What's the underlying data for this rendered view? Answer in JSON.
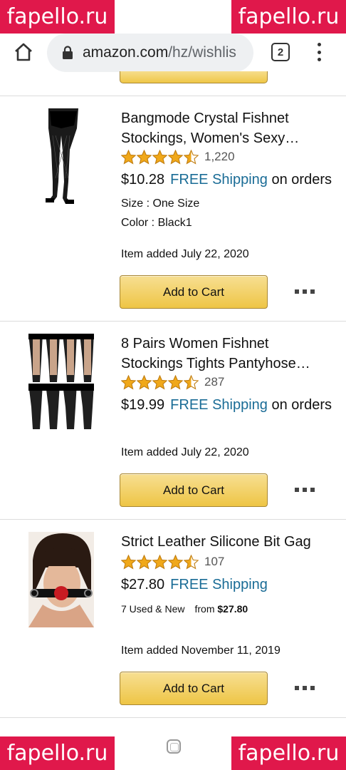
{
  "browser": {
    "url_domain": "amazon.com",
    "url_path": "/hz/wishlis",
    "tab_count": "2"
  },
  "items": [
    {
      "title_line1": "Bangmode Crystal Fishnet",
      "title_line2": "Stockings, Women's Sexy…",
      "rating": 4.5,
      "review_count": "1,220",
      "price": "$10.28",
      "free_shipping": "FREE Shipping",
      "shipping_suffix": "on orders",
      "size": "Size : One Size",
      "color": "Color : Black1",
      "added": "Item added July 22, 2020",
      "cart_label": "Add to Cart"
    },
    {
      "title_line1": "8 Pairs Women Fishnet",
      "title_line2": "Stockings Tights Pantyhose…",
      "rating": 4.5,
      "review_count": "287",
      "price": "$19.99",
      "free_shipping": "FREE Shipping",
      "shipping_suffix": "on orders",
      "added": "Item added July 22, 2020",
      "cart_label": "Add to Cart"
    },
    {
      "title_line1": "Strict Leather Silicone Bit Gag",
      "rating": 4.5,
      "review_count": "107",
      "price": "$27.80",
      "free_shipping": "FREE Shipping",
      "used_new": "7 Used & New",
      "from_label": "from",
      "from_price": "$27.80",
      "added": "Item added November 11, 2019",
      "cart_label": "Add to Cart"
    }
  ],
  "watermark": "fapello.ru",
  "colors": {
    "link": "#1a6c96",
    "star": "#f0a81a",
    "button": "#efc748",
    "watermark_bg": "#e0184b"
  }
}
